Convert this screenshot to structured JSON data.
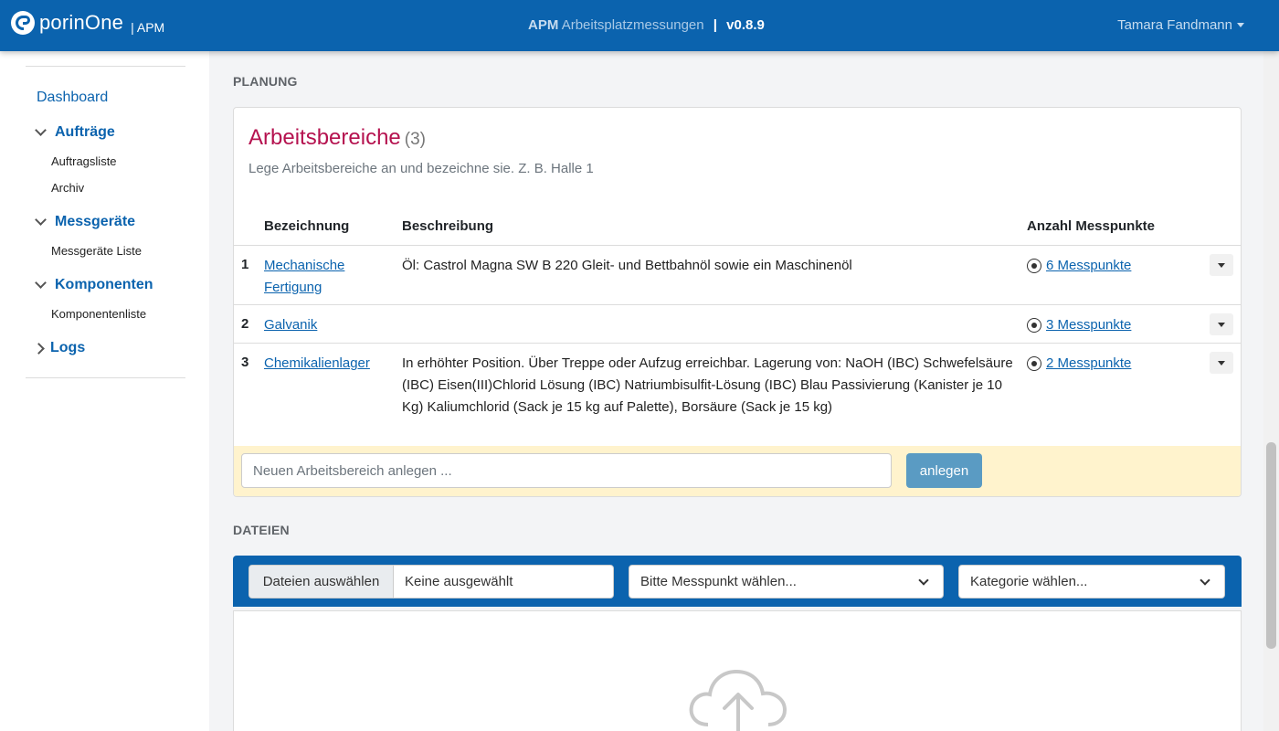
{
  "header": {
    "brand_name": "porinOne",
    "brand_sub": "| APM",
    "app_short": "APM",
    "app_long": "Arbeitsplatzmessungen",
    "separator": "|",
    "version": "v0.8.9",
    "user_name": "Tamara Fandmann"
  },
  "sidebar": {
    "dashboard": "Dashboard",
    "groups": [
      {
        "label": "Aufträge",
        "items": [
          "Auftragsliste",
          "Archiv"
        ]
      },
      {
        "label": "Messgeräte",
        "items": [
          "Messgeräte Liste"
        ]
      },
      {
        "label": "Komponenten",
        "items": [
          "Komponentenliste"
        ]
      },
      {
        "label": "Logs",
        "items": []
      }
    ]
  },
  "planung": {
    "section_label": "PLANUNG",
    "title": "Arbeitsbereiche",
    "count": "(3)",
    "description": "Lege Arbeitsbereiche an und bezeichne sie. Z. B. Halle 1",
    "columns": [
      "Bezeichnung",
      "Beschreibung",
      "Anzahl Messpunkte"
    ],
    "rows": [
      {
        "num": "1",
        "name": "Mechanische Fertigung",
        "description": "Öl: Castrol Magna SW B 220 Gleit- und Bettbahnöl sowie ein Maschinenöl",
        "messpunkte": "6 Messpunkte"
      },
      {
        "num": "2",
        "name": "Galvanik",
        "description": "",
        "messpunkte": "3 Messpunkte"
      },
      {
        "num": "3",
        "name": "Chemikalienlager",
        "description": "In erhöhter Position. Über Treppe oder Aufzug erreichbar. Lagerung von: NaOH (IBC) Schwefelsäure (IBC) Eisen(III)Chlorid Lösung (IBC) Natriumbisulfit-Lösung (IBC) Blau Passivierung (Kanister je 10 Kg) Kaliumchlorid (Sack je 15 kg auf Palette), Borsäure (Sack je 15 kg)",
        "messpunkte": "2 Messpunkte"
      }
    ],
    "new_placeholder": "Neuen Arbeitsbereich anlegen ...",
    "new_button": "anlegen"
  },
  "dateien": {
    "section_label": "DATEIEN",
    "file_button": "Dateien auswählen",
    "file_status": "Keine ausgewählt",
    "messpunkt_select": "Bitte Messpunkt wählen...",
    "kategorie_select": "Kategorie wählen..."
  },
  "colors": {
    "primary": "#0b63ae",
    "accent_title": "#b5124f",
    "new_row_bg": "#fff3cd"
  }
}
